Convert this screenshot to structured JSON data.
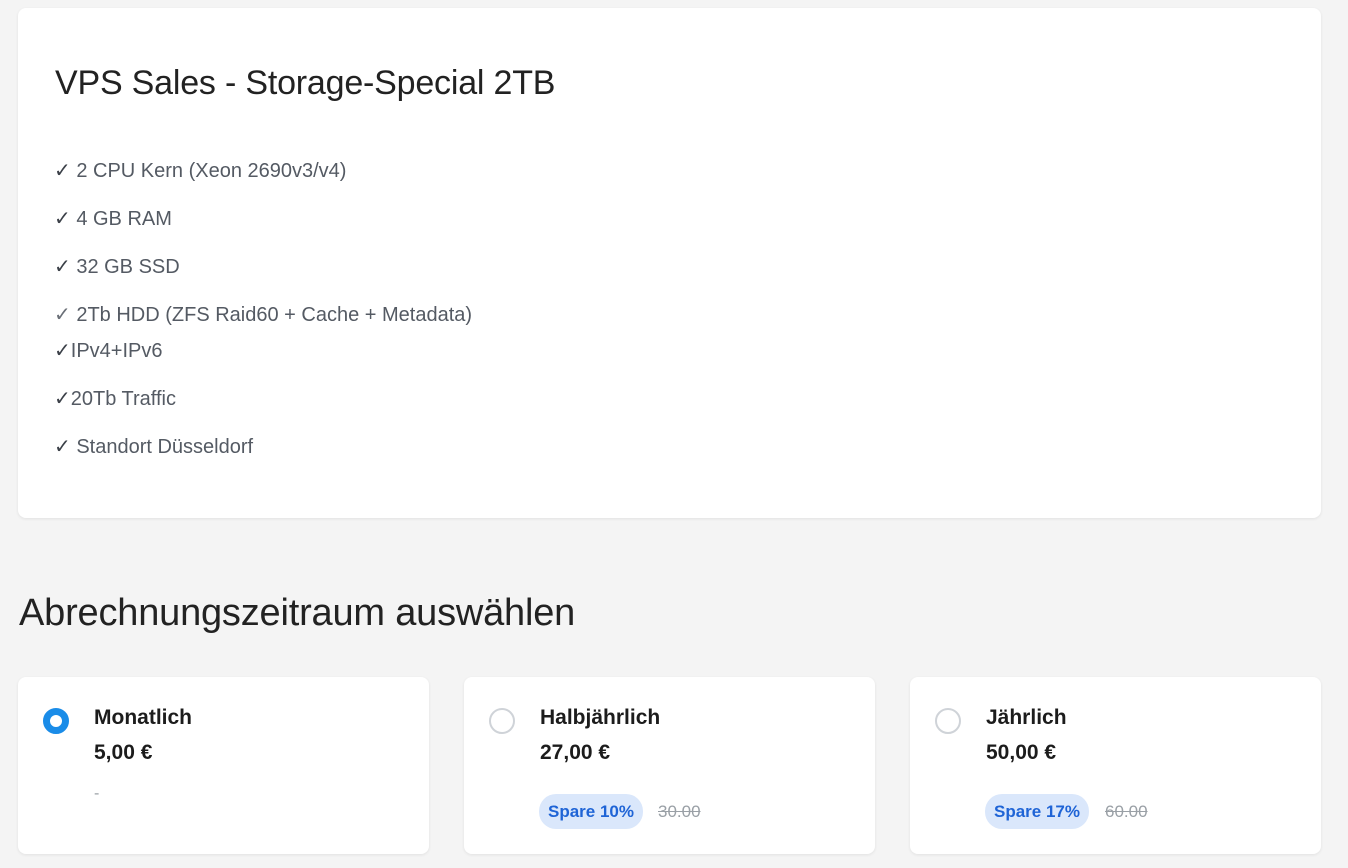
{
  "product": {
    "title": "VPS Sales - Storage-Special 2TB",
    "features": [
      {
        "check": "✓",
        "text": " 2 CPU Kern (Xeon 2690v3/v4)"
      },
      {
        "check": "✓",
        "text": " 4 GB RAM"
      },
      {
        "check": "✓",
        "text": " 32 GB SSD"
      },
      {
        "check": "✓",
        "text": " 2Tb HDD (ZFS Raid60 + Cache + Metadata)"
      },
      {
        "check": "✓",
        "text": "IPv4+IPv6"
      },
      {
        "check": "✓",
        "text": "20Tb Traffic"
      },
      {
        "check": "✓",
        "text": " Standort Düsseldorf"
      }
    ]
  },
  "billing": {
    "heading": "Abrechnungszeitraum auswählen",
    "selected_index": 0,
    "accent_color": "#1a8ce8",
    "options": [
      {
        "name": "Monatlich",
        "price": "5,00 €",
        "note": "-",
        "checked": true
      },
      {
        "name": "Halbjährlich",
        "price": "27,00 €",
        "save": "Spare 10%",
        "old_price": "30.00",
        "checked": false
      },
      {
        "name": "Jährlich",
        "price": "50,00 €",
        "save": "Spare 17%",
        "old_price": "60.00",
        "checked": false
      }
    ]
  }
}
